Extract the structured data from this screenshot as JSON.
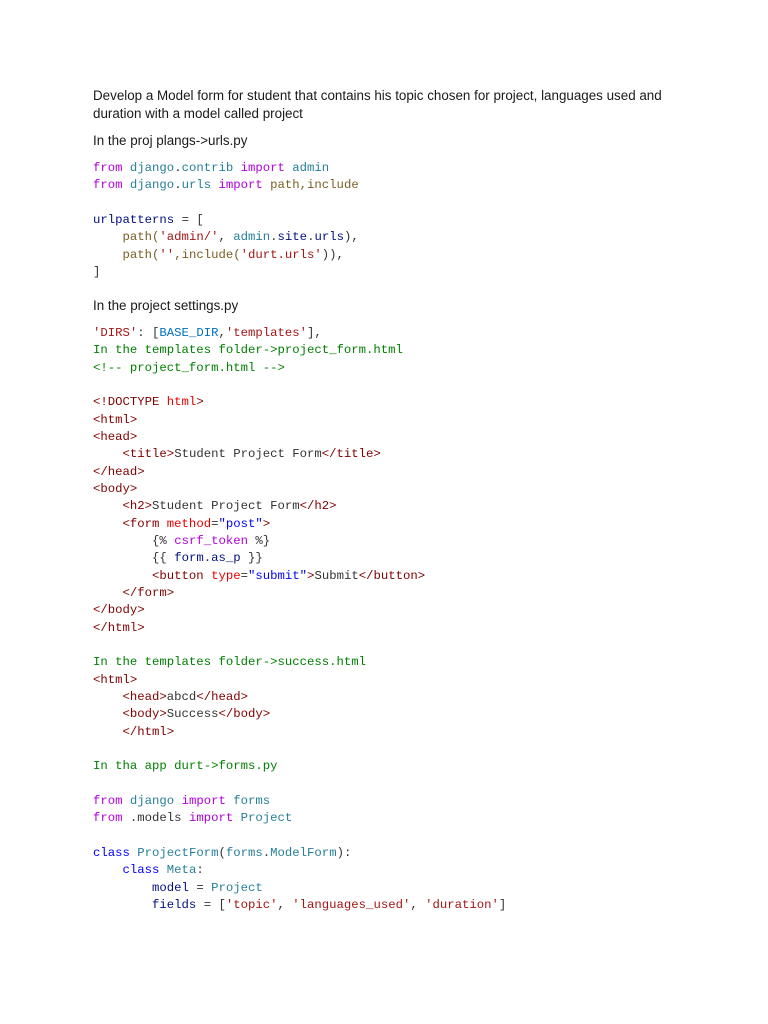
{
  "intro": "Develop a Model form for student that contains his topic chosen for project, languages used and duration with a model called project",
  "para_urls": "In the proj plangs->urls.py",
  "para_settings": "In the project settings.py",
  "code_blocks": [
    [
      [
        [
          "from",
          "kw"
        ],
        [
          " django",
          "mod"
        ],
        [
          ".",
          "txt"
        ],
        [
          "contrib",
          "mod"
        ],
        [
          " import",
          "kw"
        ],
        [
          " admin",
          "mod"
        ]
      ],
      [
        [
          "from",
          "kw"
        ],
        [
          " django",
          "mod"
        ],
        [
          ".",
          "txt"
        ],
        [
          "urls",
          "mod"
        ],
        [
          " import",
          "kw"
        ],
        [
          " path,include",
          "fn"
        ]
      ],
      [],
      [
        [
          "urlpatterns",
          "var"
        ],
        [
          " = [",
          "txt"
        ]
      ],
      [
        [
          "    path(",
          "fn"
        ],
        [
          "'admin/'",
          "str"
        ],
        [
          ", ",
          "txt"
        ],
        [
          "admin",
          "mod"
        ],
        [
          ".",
          "txt"
        ],
        [
          "site",
          "var"
        ],
        [
          ".",
          "txt"
        ],
        [
          "urls",
          "var"
        ],
        [
          "),",
          "txt"
        ]
      ],
      [
        [
          "    path(",
          "fn"
        ],
        [
          "''",
          "str"
        ],
        [
          ",include(",
          "fn"
        ],
        [
          "'durt.urls'",
          "str"
        ],
        [
          ")),",
          "txt"
        ]
      ],
      [
        [
          "]",
          "txt"
        ]
      ]
    ],
    [
      [
        [
          "'DIRS'",
          "str"
        ],
        [
          ": [",
          "txt"
        ],
        [
          "BASE_DIR",
          "cst"
        ],
        [
          ",",
          "txt"
        ],
        [
          "'templates'",
          "str"
        ],
        [
          "],",
          "txt"
        ]
      ],
      [
        [
          "In the templates folder->project_form.html",
          "cm"
        ]
      ],
      [
        [
          "<!-- project_form.html -->",
          "cm"
        ]
      ],
      [],
      [
        [
          "<!DOCTYPE ",
          "tag"
        ],
        [
          "html",
          "attr"
        ],
        [
          ">",
          "tag"
        ]
      ],
      [
        [
          "<html>",
          "tag"
        ]
      ],
      [
        [
          "<head>",
          "tag"
        ]
      ],
      [
        [
          "    <title>",
          "tag"
        ],
        [
          "Student Project Form",
          "txt"
        ],
        [
          "</title>",
          "tag"
        ]
      ],
      [
        [
          "</head>",
          "tag"
        ]
      ],
      [
        [
          "<body>",
          "tag"
        ]
      ],
      [
        [
          "    <h2>",
          "tag"
        ],
        [
          "Student Project Form",
          "txt"
        ],
        [
          "</h2>",
          "tag"
        ]
      ],
      [
        [
          "    <form ",
          "tag"
        ],
        [
          "method",
          "attr"
        ],
        [
          "=",
          "txt"
        ],
        [
          "\"post\"",
          "av"
        ],
        [
          ">",
          "tag"
        ]
      ],
      [
        [
          "        {% ",
          "txt"
        ],
        [
          "csrf_token",
          "kw"
        ],
        [
          " %}",
          "txt"
        ]
      ],
      [
        [
          "        {{ ",
          "txt"
        ],
        [
          "form",
          "var"
        ],
        [
          ".",
          "txt"
        ],
        [
          "as_p",
          "var"
        ],
        [
          " }}",
          "txt"
        ]
      ],
      [
        [
          "        <button ",
          "tag"
        ],
        [
          "type",
          "attr"
        ],
        [
          "=",
          "txt"
        ],
        [
          "\"submit\"",
          "av"
        ],
        [
          ">",
          "tag"
        ],
        [
          "Submit",
          "txt"
        ],
        [
          "</button>",
          "tag"
        ]
      ],
      [
        [
          "    </form>",
          "tag"
        ]
      ],
      [
        [
          "</body>",
          "tag"
        ]
      ],
      [
        [
          "</html>",
          "tag"
        ]
      ],
      [],
      [
        [
          "In the templates folder->success.html",
          "cm"
        ]
      ],
      [
        [
          "<html>",
          "tag"
        ]
      ],
      [
        [
          "    <head>",
          "tag"
        ],
        [
          "abcd",
          "txt"
        ],
        [
          "</head>",
          "tag"
        ]
      ],
      [
        [
          "    <body>",
          "tag"
        ],
        [
          "Success",
          "txt"
        ],
        [
          "</body>",
          "tag"
        ]
      ],
      [
        [
          "    </html>",
          "tag"
        ]
      ],
      [],
      [
        [
          "In tha app durt->forms.py",
          "cm"
        ]
      ],
      [],
      [
        [
          "from",
          "kw"
        ],
        [
          " django",
          "mod"
        ],
        [
          " import",
          "kw"
        ],
        [
          " forms",
          "mod"
        ]
      ],
      [
        [
          "from",
          "kw"
        ],
        [
          " .models",
          "txt"
        ],
        [
          " import",
          "kw"
        ],
        [
          " Project",
          "mod"
        ]
      ],
      [],
      [
        [
          "class",
          "ckw"
        ],
        [
          " ProjectForm",
          "mod"
        ],
        [
          "(",
          "txt"
        ],
        [
          "forms",
          "mod"
        ],
        [
          ".",
          "txt"
        ],
        [
          "ModelForm",
          "mod"
        ],
        [
          "):",
          "txt"
        ]
      ],
      [
        [
          "    class",
          "ckw"
        ],
        [
          " Meta",
          "mod"
        ],
        [
          ":",
          "txt"
        ]
      ],
      [
        [
          "        model",
          "var"
        ],
        [
          " = ",
          "txt"
        ],
        [
          "Project",
          "mod"
        ]
      ],
      [
        [
          "        fields",
          "var"
        ],
        [
          " = [",
          "txt"
        ],
        [
          "'topic'",
          "str"
        ],
        [
          ", ",
          "txt"
        ],
        [
          "'languages_used'",
          "str"
        ],
        [
          ", ",
          "txt"
        ],
        [
          "'duration'",
          "str"
        ],
        [
          "]",
          "txt"
        ]
      ]
    ]
  ]
}
